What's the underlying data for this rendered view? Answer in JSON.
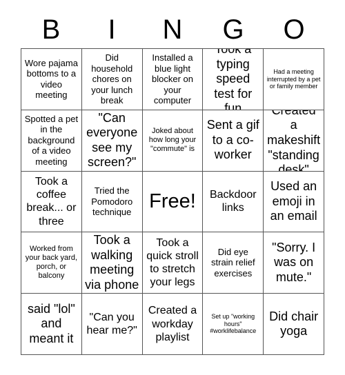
{
  "card": {
    "header_letters": [
      "B",
      "I",
      "N",
      "G",
      "O"
    ],
    "columns": 5,
    "rows": 5,
    "colors": {
      "background": "#ffffff",
      "text": "#000000",
      "grid_line": "#555555"
    },
    "cells": [
      {
        "text": "Wore pajama bottoms to a video meeting",
        "size": "md",
        "marked": false
      },
      {
        "text": "Did household chores on your lunch break",
        "size": "md",
        "marked": false
      },
      {
        "text": "Installed a blue light blocker on your computer",
        "size": "md",
        "marked": false
      },
      {
        "text": "Took a typing speed test for fun",
        "size": "xl",
        "marked": false
      },
      {
        "text": "Had a meeting interrupted by a pet or family member",
        "size": "xs",
        "marked": false
      },
      {
        "text": "Spotted a pet in the background of a video meeting",
        "size": "md",
        "marked": false
      },
      {
        "text": "\"Can everyone see my screen?\"",
        "size": "xl",
        "marked": false
      },
      {
        "text": "Joked about how long your \"commute\" is",
        "size": "sm",
        "marked": false
      },
      {
        "text": "Sent a gif to a co-worker",
        "size": "xl",
        "marked": false
      },
      {
        "text": "Created a makeshift \"standing desk\"",
        "size": "xl",
        "marked": false
      },
      {
        "text": "Took a coffee break... or three",
        "size": "lg",
        "marked": false
      },
      {
        "text": "Tried the Pomodoro technique",
        "size": "md",
        "marked": false
      },
      {
        "text": "Free!",
        "size": "free",
        "marked": false
      },
      {
        "text": "Backdoor links",
        "size": "lg",
        "marked": false
      },
      {
        "text": "Used an emoji in an email",
        "size": "xl",
        "marked": false
      },
      {
        "text": "Worked from your back yard, porch, or balcony",
        "size": "sm",
        "marked": false
      },
      {
        "text": "Took a walking meeting via phone",
        "size": "xl",
        "marked": false
      },
      {
        "text": "Took a quick stroll to stretch your legs",
        "size": "lg",
        "marked": false
      },
      {
        "text": "Did eye strain relief exercises",
        "size": "md",
        "marked": false
      },
      {
        "text": "\"Sorry. I was on mute.\"",
        "size": "xl",
        "marked": false
      },
      {
        "text": "said \"lol\" and meant it",
        "size": "xl",
        "marked": false
      },
      {
        "text": "\"Can you hear me?\"",
        "size": "lg",
        "marked": false
      },
      {
        "text": "Created a workday playlist",
        "size": "lg",
        "marked": false
      },
      {
        "text": "Set up \"working hours\" #worklifebalance",
        "size": "xs",
        "marked": false
      },
      {
        "text": "Did chair yoga",
        "size": "xl",
        "marked": false
      }
    ]
  }
}
